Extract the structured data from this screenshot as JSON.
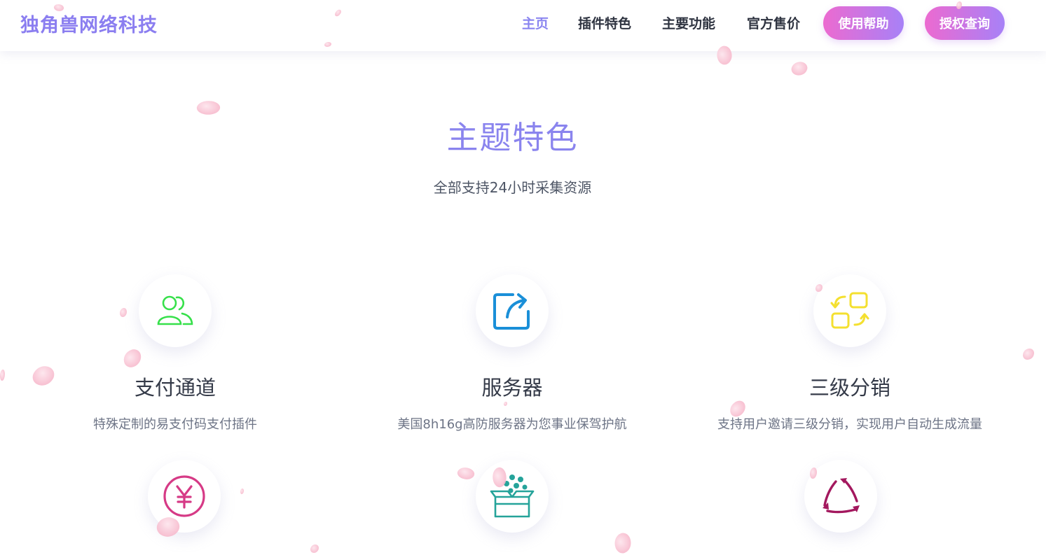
{
  "header": {
    "brand": "独角兽网络科技",
    "nav": [
      {
        "label": "主页",
        "active": true
      },
      {
        "label": "插件特色"
      },
      {
        "label": "主要功能"
      },
      {
        "label": "官方售价"
      }
    ],
    "help_button": "使用帮助",
    "auth_button": "授权查询",
    "colors": {
      "brand": "#8b7ef0",
      "active": "#8a85f0",
      "button_gradient": [
        "#ec6ad0",
        "#a781f7"
      ]
    }
  },
  "section": {
    "title": "主题特色",
    "subtitle": "全部支持24小时采集资源"
  },
  "features": [
    {
      "icon": "users-icon",
      "title": "支付通道",
      "desc": "特殊定制的易支付码支付插件",
      "color": "#36e04a"
    },
    {
      "icon": "share-icon",
      "title": "服务器",
      "desc": "美国8h16g高防服务器为您事业保驾护航",
      "color": "#1a8fd8"
    },
    {
      "icon": "swap-icon",
      "title": "三级分销",
      "desc": "支持用户邀请三级分销，实现用户自动生成流量",
      "color": "#f4e030"
    },
    {
      "icon": "yen-icon",
      "color": "#d63a86"
    },
    {
      "icon": "box-icon",
      "color": "#25a39a"
    },
    {
      "icon": "cycle-icon",
      "color": "#a3185e"
    }
  ]
}
